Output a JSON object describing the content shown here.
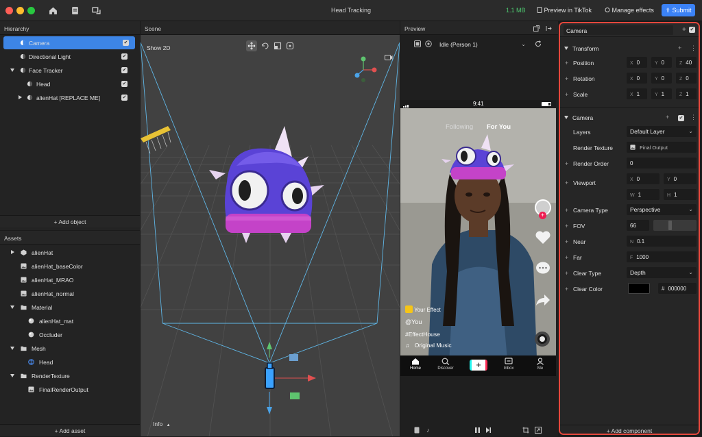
{
  "titlebar": {
    "title": "Head Tracking",
    "size": "1.1 MB",
    "preview_label": "Preview in TikTok",
    "manage_label": "Manage effects",
    "submit_label": "Submit"
  },
  "hierarchy": {
    "header": "Hierarchy",
    "items": [
      {
        "label": "Camera"
      },
      {
        "label": "Directional Light"
      },
      {
        "label": "Face Tracker"
      },
      {
        "label": "Head"
      },
      {
        "label": "alienHat [REPLACE ME]"
      }
    ],
    "add_label": "+ Add object"
  },
  "assets": {
    "header": "Assets",
    "items": [
      {
        "label": "alienHat"
      },
      {
        "label": "alienHat_baseColor"
      },
      {
        "label": "alienHat_MRAO"
      },
      {
        "label": "alienHat_normal"
      },
      {
        "label": "Material"
      },
      {
        "label": "alienHat_mat"
      },
      {
        "label": "Occluder"
      },
      {
        "label": "Mesh"
      },
      {
        "label": "Head"
      },
      {
        "label": "RenderTexture"
      },
      {
        "label": "FinalRenderOutput"
      }
    ],
    "add_label": "+ Add asset"
  },
  "scene": {
    "header": "Scene",
    "show2d": "Show 2D",
    "info": "Info"
  },
  "preview": {
    "header": "Preview",
    "anim": "Idle (Person 1)",
    "time": "9:41",
    "following": "Following",
    "foryou": "For You",
    "your_effect": "Your Effect",
    "you": "@You",
    "hashtag": "#EffectHouse",
    "music": "Original Music",
    "nav": [
      "Home",
      "Discover",
      "Inbox",
      "Me"
    ]
  },
  "inspector": {
    "name": "Camera",
    "transform": {
      "title": "Transform",
      "position_label": "Position",
      "position": {
        "x": "0",
        "y": "0",
        "z": "40"
      },
      "rotation_label": "Rotation",
      "rotation": {
        "x": "0",
        "y": "0",
        "z": "0"
      },
      "scale_label": "Scale",
      "scale": {
        "x": "1",
        "y": "1",
        "z": "1"
      }
    },
    "camera": {
      "title": "Camera",
      "layers_label": "Layers",
      "layers": "Default Layer",
      "render_texture_label": "Render Texture",
      "render_texture": "Final Output",
      "render_order_label": "Render Order",
      "render_order": "0",
      "viewport_label": "Viewport",
      "viewport": {
        "x": "0",
        "y": "0",
        "w": "1",
        "h": "1"
      },
      "camera_type_label": "Camera Type",
      "camera_type": "Perspective",
      "fov_label": "FOV",
      "fov": "66",
      "near_label": "Near",
      "near": "0.1",
      "far_label": "Far",
      "far": "1000",
      "clear_type_label": "Clear Type",
      "clear_type": "Depth",
      "clear_color_label": "Clear Color",
      "clear_color_hex": "000000"
    },
    "add_component": "+ Add component"
  },
  "colors": {
    "accent": "#3b82f6",
    "selection": "#3d85e6",
    "highlight_border": "#e5473c"
  }
}
